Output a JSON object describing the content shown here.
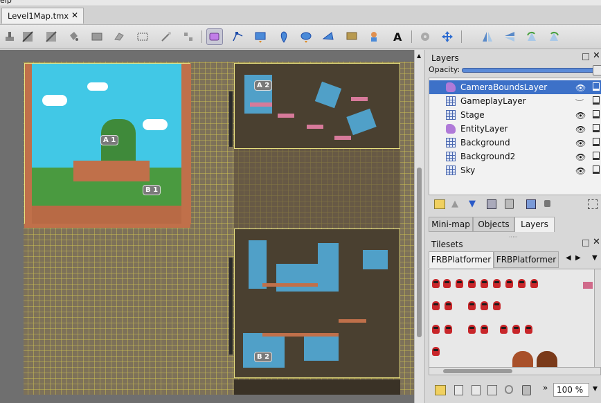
{
  "menubar": {
    "partial_text": "elp"
  },
  "document_tab": {
    "title": "Level1Map.tmx",
    "close_glyph": "✕"
  },
  "toolbar": {
    "tools": [
      "stamp-brush-icon",
      "terrain-brush-icon",
      "wang-brush-icon",
      "bucket-fill-icon",
      "shape-fill-icon",
      "eraser-icon",
      "rectangular-select-icon",
      "magic-wand-icon",
      "select-same-tile-icon",
      "select-objects-icon",
      "edit-polygons-icon",
      "insert-rectangle-icon",
      "insert-point-icon",
      "insert-ellipse-icon",
      "insert-polygon-icon",
      "insert-tile-icon",
      "insert-template-icon",
      "insert-text-icon",
      "auto-map-icon",
      "move-icon",
      "flip-horizontal-icon",
      "flip-vertical-icon",
      "rotate-left-icon",
      "rotate-right-icon"
    ],
    "active_tool": "select-objects-icon"
  },
  "map": {
    "object_labels": [
      "A 1",
      "B 1",
      "A 2",
      "B 2"
    ]
  },
  "layers_panel": {
    "title": "Layers",
    "opacity_label": "Opacity:",
    "opacity": 1.0,
    "layers": [
      {
        "name": "CameraBoundsLayer",
        "type": "object",
        "selected": true,
        "visible": true
      },
      {
        "name": "GameplayLayer",
        "type": "tile",
        "selected": false,
        "visible": false
      },
      {
        "name": "Stage",
        "type": "tile",
        "selected": false,
        "visible": true
      },
      {
        "name": "EntityLayer",
        "type": "object",
        "selected": false,
        "visible": true
      },
      {
        "name": "Background",
        "type": "tile",
        "selected": false,
        "visible": true
      },
      {
        "name": "Background2",
        "type": "tile",
        "selected": false,
        "visible": true
      },
      {
        "name": "Sky",
        "type": "tile",
        "selected": false,
        "visible": true
      }
    ],
    "tabs": [
      "Mini-map",
      "Objects",
      "Layers"
    ],
    "active_tab": "Layers"
  },
  "tilesets_panel": {
    "title": "Tilesets",
    "tabs": [
      "FRBPlatformer",
      "FRBPlatformer"
    ],
    "active_tab": 0,
    "zoom": "100 %"
  },
  "colors": {
    "selection": "#3d71c8",
    "grid": "#d2c850",
    "sky": "#41c8e6"
  }
}
